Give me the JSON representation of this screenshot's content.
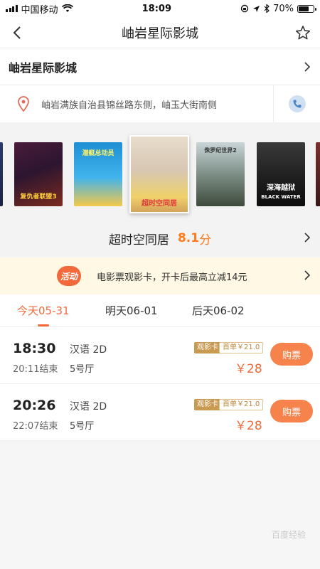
{
  "status_bar": {
    "carrier": "中国移动",
    "time": "18:09",
    "battery": "70%",
    "battery_level": 0.7
  },
  "nav": {
    "title": "岫岩星际影城"
  },
  "cinema": {
    "name": "岫岩星际影城",
    "address": "岫岩满族自治县锦丝路东侧，岫玉大街南侧"
  },
  "posters": [
    {
      "title": "复仇者联盟3"
    },
    {
      "title": "潜艇总动员"
    },
    {
      "title": "超时空同居",
      "selected": true
    },
    {
      "title": "侏罗纪世界2"
    },
    {
      "title": "深海越狱",
      "subtitle": "BLACK WATER"
    }
  ],
  "selected_movie": {
    "name": "超时空同居",
    "score": "8.1",
    "score_unit": "分"
  },
  "promo": {
    "badge": "活动",
    "text": "电影票观影卡，开卡后最高立减14元"
  },
  "date_tabs": [
    "今天05-31",
    "明天06-01",
    "后天06-02"
  ],
  "showtimes": [
    {
      "start": "18:30",
      "end": "20:11结束",
      "language": "汉语 2D",
      "hall": "5号厅",
      "card_tag": "观影卡",
      "first_order": "首单￥21.0",
      "price": "￥28",
      "buy_label": "购票"
    },
    {
      "start": "20:26",
      "end": "22:07结束",
      "language": "汉语 2D",
      "hall": "5号厅",
      "card_tag": "观影卡",
      "first_order": "首单￥21.0",
      "price": "￥28",
      "buy_label": "购票"
    }
  ],
  "watermark": "百度经验",
  "colors": {
    "accent": "#f26a3c",
    "score": "#ff7a1a",
    "promo_bg": "#fff8e4",
    "gold": "#c89a52"
  }
}
